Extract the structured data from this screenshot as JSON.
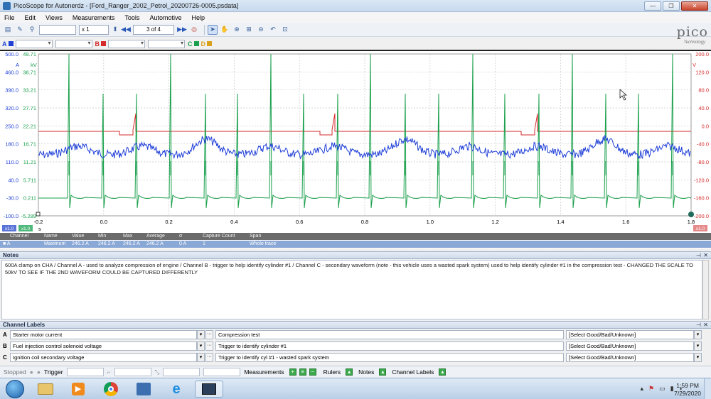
{
  "window": {
    "title": "PicoScope for Autonerdz - [Ford_Ranger_2002_Petrol_20200726-0005.psdata]",
    "buttons": [
      "—",
      "❐",
      "✕"
    ]
  },
  "menu": [
    "File",
    "Edit",
    "Views",
    "Measurements",
    "Tools",
    "Automotive",
    "Help"
  ],
  "toolbar": {
    "zoom_label": "x 1",
    "buffer_label": "3 of 4"
  },
  "logo": {
    "text": "pico",
    "sub": "Technology"
  },
  "channels": {
    "A": {
      "letter": "A",
      "color": "#1f3fd8"
    },
    "B": {
      "letter": "B",
      "color": "#d62b2b"
    },
    "C": {
      "letter": "C",
      "color": "#1aa04c"
    },
    "D": {
      "letter": "D",
      "color": "#d9a21c"
    }
  },
  "scope": {
    "axis_A": {
      "unit": "A",
      "ticks": [
        "500.0",
        "460.0",
        "390.0",
        "320.0",
        "250.0",
        "180.0",
        "110.0",
        "40.0",
        "-30.0",
        "-100.0"
      ]
    },
    "axis_C": {
      "unit": "kV",
      "ticks": [
        "49.71",
        "38.71",
        "33.21",
        "27.71",
        "22.21",
        "16.71",
        "11.21",
        "5.711",
        "0.211",
        "-5.289"
      ]
    },
    "axis_B": {
      "unit": "V",
      "ticks": [
        "200.0",
        "120.0",
        "80.0",
        "40.0",
        "0.0",
        "-40.0",
        "-80.0",
        "-120.0",
        "-160.0",
        "-200.0"
      ]
    },
    "x_ticks": [
      "-0.2",
      "0.0",
      "0.2",
      "0.4",
      "0.6",
      "0.8",
      "1.0",
      "1.2",
      "1.4",
      "1.6",
      "1.8"
    ],
    "x_unit": "s",
    "zoom_tag_left": "x1.0",
    "zoom_tag_mid": "x1.0",
    "zoom_tag_right": "x1.0"
  },
  "measurements": {
    "headers": [
      "Channel",
      "Name",
      "Value",
      "Min",
      "Max",
      "Average",
      "σ",
      "Capture Count",
      "Span"
    ],
    "rows": [
      [
        "A",
        "Maximum",
        "246.2 A",
        "246.2 A",
        "246.2 A",
        "246.2 A",
        "0 A",
        "1",
        "Whole trace"
      ]
    ]
  },
  "notes": {
    "title": "Notes",
    "text": "600A clamp on CHA / Channel A - used to analyze compression of engine  / Channel B - trigger to help identify cylinder #1 / Channel C - secondary waveform (note - this vehicle uses a wasted spark system) used to help identify cylinder #1 in the compression test  - CHANGED THE SCALE TO 50kV TO SEE IF THE 2ND WAVEFORM COULD BE CAPTURED DIFFERENTLY"
  },
  "channel_labels": {
    "title": "Channel Labels",
    "rows": [
      {
        "ch": "A",
        "label": "Starter motor current",
        "desc": "Compression test",
        "rating": "[Select Good/Bad/Unknown]"
      },
      {
        "ch": "B",
        "label": "Fuel injection control solenoid voltage",
        "desc": "Trigger to identify cylinder #1",
        "rating": "[Select Good/Bad/Unknown]"
      },
      {
        "ch": "C",
        "label": "Ignition coil secondary voltage",
        "desc": "Trigger to identify cyl #1 - wasted spark system",
        "rating": "[Select Good/Bad/Unknown]"
      }
    ]
  },
  "status": {
    "stopped": "Stopped",
    "trigger": "Trigger",
    "measurements": "Measurements",
    "rulers": "Rulers",
    "notes": "Notes",
    "channel_labels": "Channel Labels"
  },
  "clock": {
    "time": "1:59 PM",
    "date": "7/29/2020"
  }
}
